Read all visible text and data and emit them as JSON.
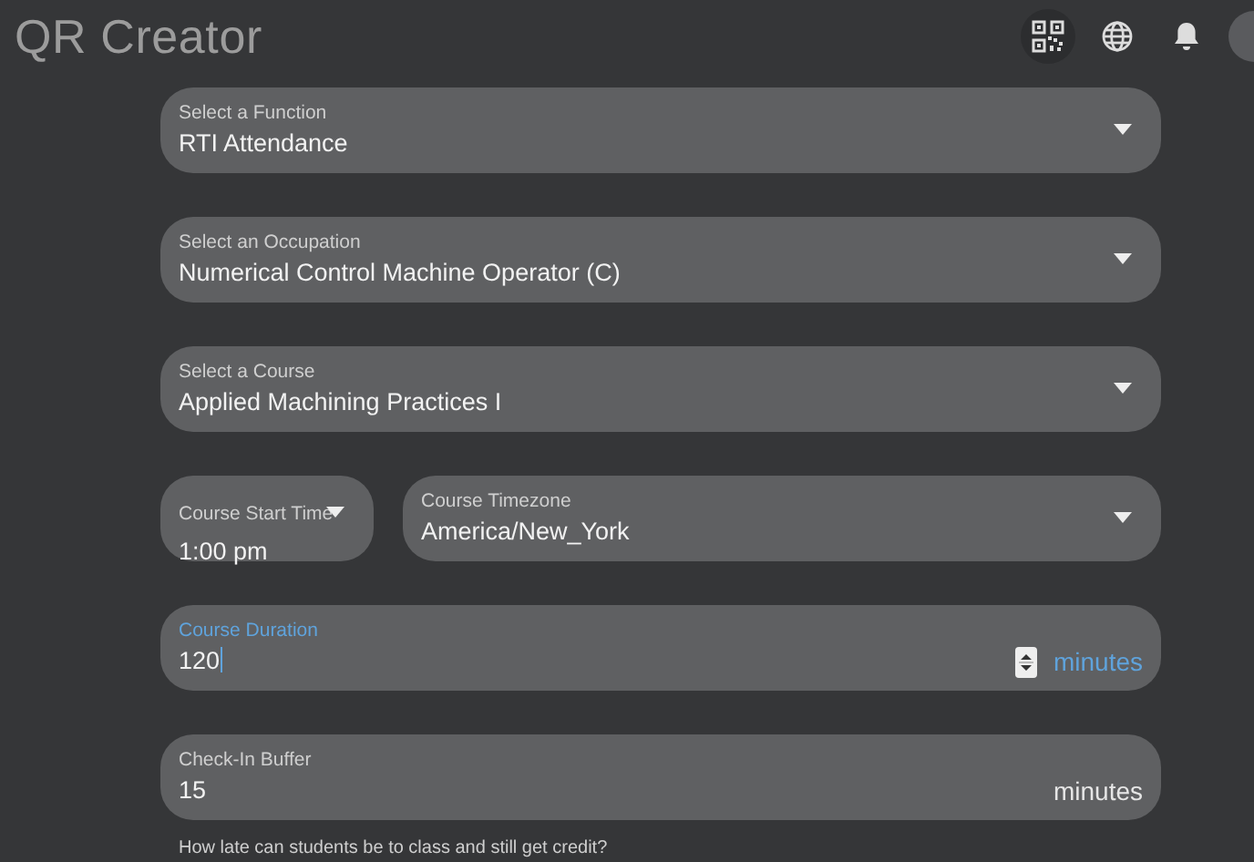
{
  "header": {
    "title": "QR Creator"
  },
  "rows": [
    {
      "fields": [
        {
          "kind": "select",
          "label": "Select a Function",
          "value": "RTI Attendance",
          "focused": false
        }
      ]
    },
    {
      "fields": [
        {
          "kind": "select",
          "label": "Select an Occupation",
          "value": "Numerical Control Machine Operator (C)",
          "focused": false
        }
      ]
    },
    {
      "fields": [
        {
          "kind": "select",
          "label": "Select a Course",
          "value": "Applied Machining Practices I",
          "focused": false
        }
      ]
    },
    {
      "fields": [
        {
          "kind": "select",
          "label": "Course Start Time",
          "value": "1:00 pm",
          "focused": false
        },
        {
          "kind": "select",
          "label": "Course Timezone",
          "value": "America/New_York",
          "focused": false
        }
      ]
    },
    {
      "fields": [
        {
          "kind": "number",
          "label": "Course Duration",
          "value": "120",
          "suffix": "minutes",
          "focused": true
        }
      ]
    },
    {
      "fields": [
        {
          "kind": "number",
          "label": "Check-In Buffer",
          "value": "15",
          "suffix": "minutes",
          "focused": false,
          "hint": "How late can students be to class and still get credit?"
        }
      ]
    }
  ]
}
